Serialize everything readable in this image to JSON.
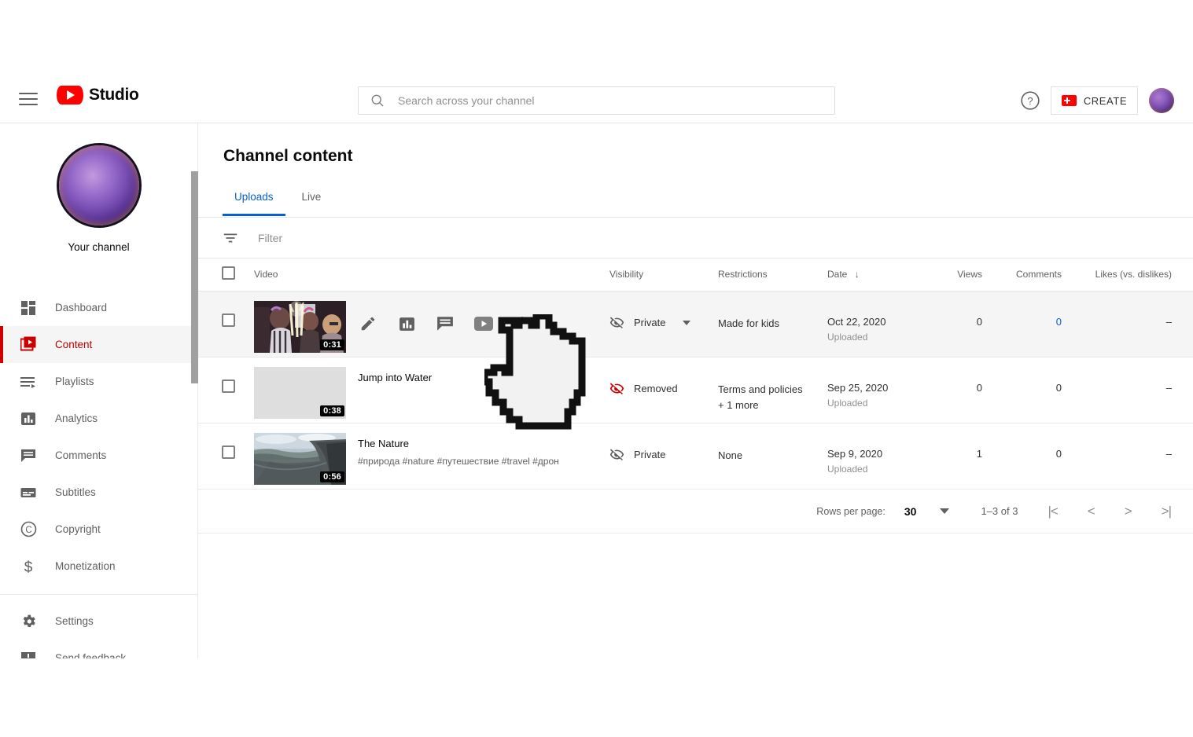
{
  "header": {
    "menu_icon": "hamburger-menu-icon",
    "brand": "Studio",
    "brand_logo_icon": "youtube-logo-icon",
    "search": {
      "icon": "search-icon",
      "placeholder": "Search across your channel",
      "value": ""
    },
    "help_icon": "help-circle-icon",
    "create_button": {
      "label": "CREATE",
      "icon": "video-camera-plus-icon"
    },
    "account_avatar": "account-avatar"
  },
  "sidebar": {
    "channel_name": "Your channel",
    "channel_avatar": "channel-avatar",
    "items": [
      {
        "label": "Dashboard",
        "icon": "dashboard-grid-icon",
        "active": false
      },
      {
        "label": "Content",
        "icon": "content-video-icon",
        "active": true
      },
      {
        "label": "Playlists",
        "icon": "playlist-icon",
        "active": false
      },
      {
        "label": "Analytics",
        "icon": "analytics-bars-icon",
        "active": false
      },
      {
        "label": "Comments",
        "icon": "comment-bubble-icon",
        "active": false
      },
      {
        "label": "Subtitles",
        "icon": "subtitles-icon",
        "active": false
      },
      {
        "label": "Copyright",
        "icon": "copyright-icon",
        "active": false
      }
    ],
    "items_bottom": [
      {
        "label": "Monetization",
        "icon": "dollar-sign-icon",
        "active": false
      },
      {
        "label": "Settings",
        "icon": "gear-icon",
        "active": false
      },
      {
        "label": "Send feedback",
        "icon": "feedback-icon",
        "active": false
      }
    ],
    "scrollbar": "sidebar-scrollbar"
  },
  "main": {
    "page_title": "Channel content",
    "tabs": [
      {
        "label": "Uploads",
        "active": true
      },
      {
        "label": "Live",
        "active": false
      }
    ],
    "filter": {
      "icon": "filter-icon",
      "placeholder": "Filter"
    },
    "columns": {
      "select_all": "select-all-checkbox",
      "video": "Video",
      "visibility": "Visibility",
      "restrictions": "Restrictions",
      "date": "Date",
      "date_sort_icon": "arrow-down-icon",
      "views": "Views",
      "comments": "Comments",
      "likes": "Likes (vs. dislikes)"
    },
    "rows": [
      {
        "hovered": true,
        "title": "",
        "description": "",
        "duration": "0:31",
        "thumbnail": "party-sparklers-thumbnail",
        "visibility": "Private",
        "visibility_icon": "eye-off-icon",
        "visibility_color": "#606060",
        "restrictions": "Made for kids",
        "restrictions_extra": "",
        "date": "Oct 22, 2020",
        "date_sub": "Uploaded",
        "views": "0",
        "comments": "0",
        "comments_is_link": true,
        "likes": "–",
        "actions": [
          {
            "icon": "pencil-edit-icon",
            "name": "edit-details-button"
          },
          {
            "icon": "analytics-bars-icon",
            "name": "analytics-button"
          },
          {
            "icon": "comment-bubble-icon",
            "name": "comments-button"
          },
          {
            "icon": "youtube-play-icon",
            "name": "view-on-youtube-button"
          },
          {
            "icon": "more-vertical-icon",
            "name": "options-menu-button"
          }
        ]
      },
      {
        "hovered": false,
        "title": "Jump into Water",
        "description": "",
        "duration": "0:38",
        "thumbnail": "blank-grey-thumbnail",
        "visibility": "Removed",
        "visibility_icon": "eye-off-icon",
        "visibility_color": "#cc0000",
        "restrictions": "Terms and policies",
        "restrictions_extra": "+ 1 more",
        "date": "Sep 25, 2020",
        "date_sub": "Uploaded",
        "views": "0",
        "comments": "0",
        "comments_is_link": false,
        "likes": "–",
        "actions": []
      },
      {
        "hovered": false,
        "title": "The Nature",
        "description": "#природа #nature #путешествие #travel #дрон",
        "duration": "0:56",
        "thumbnail": "fjord-cliff-thumbnail",
        "visibility": "Private",
        "visibility_icon": "eye-off-icon",
        "visibility_color": "#606060",
        "restrictions": "None",
        "restrictions_extra": "",
        "date": "Sep 9, 2020",
        "date_sub": "Uploaded",
        "views": "1",
        "comments": "0",
        "comments_is_link": false,
        "likes": "–",
        "actions": []
      }
    ],
    "pagination": {
      "rows_per_page_label": "Rows per page:",
      "rows_per_page_value": "30",
      "range": "1–3 of 3",
      "first_icon": "|<",
      "prev_icon": "<",
      "next_icon": ">",
      "last_icon": ">|"
    }
  },
  "cursor": {
    "type": "pointing-hand-cursor"
  },
  "colors": {
    "accent_blue": "#065fd4",
    "brand_red": "#ff0000",
    "active_red": "#cc0000",
    "text_primary": "#0b0b0b",
    "text_secondary": "#606060",
    "hover_row": "#f5f5f5"
  }
}
